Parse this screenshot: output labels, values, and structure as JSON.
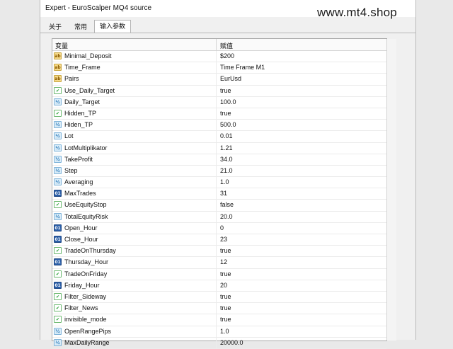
{
  "window": {
    "title": "Expert - EuroScalper MQ4 source",
    "watermark": "www.mt4.shop"
  },
  "tabs": [
    {
      "label": "关于"
    },
    {
      "label": "常用"
    },
    {
      "label": "输入参数",
      "active": true
    }
  ],
  "table": {
    "headers": {
      "variable": "变量",
      "value": "赋值"
    },
    "rows": [
      {
        "type": "ab",
        "icon": "ab",
        "name": "Minimal_Deposit",
        "value": "$200"
      },
      {
        "type": "ab",
        "icon": "ab",
        "name": "Time_Frame",
        "value": "Time Frame M1"
      },
      {
        "type": "ab",
        "icon": "ab",
        "name": "Pairs",
        "value": "EurUsd"
      },
      {
        "type": "bool",
        "icon": "✔",
        "name": "Use_Daily_Target",
        "value": "true"
      },
      {
        "type": "dbl",
        "icon": "½",
        "name": "Daily_Target",
        "value": "100.0"
      },
      {
        "type": "bool",
        "icon": "✔",
        "name": "Hidden_TP",
        "value": "true"
      },
      {
        "type": "dbl",
        "icon": "½",
        "name": "Hiden_TP",
        "value": "500.0"
      },
      {
        "type": "dbl",
        "icon": "½",
        "name": "Lot",
        "value": "0.01"
      },
      {
        "type": "dbl",
        "icon": "½",
        "name": "LotMultiplikator",
        "value": "1.21"
      },
      {
        "type": "dbl",
        "icon": "½",
        "name": "TakeProfit",
        "value": "34.0"
      },
      {
        "type": "dbl",
        "icon": "½",
        "name": "Step",
        "value": "21.0"
      },
      {
        "type": "dbl",
        "icon": "½",
        "name": "Averaging",
        "value": "1.0"
      },
      {
        "type": "int",
        "icon": "01",
        "name": "MaxTrades",
        "value": "31"
      },
      {
        "type": "bool",
        "icon": "✔",
        "name": "UseEquityStop",
        "value": "false"
      },
      {
        "type": "dbl",
        "icon": "½",
        "name": "TotalEquityRisk",
        "value": "20.0"
      },
      {
        "type": "int",
        "icon": "01",
        "name": "Open_Hour",
        "value": "0"
      },
      {
        "type": "int",
        "icon": "01",
        "name": "Close_Hour",
        "value": "23"
      },
      {
        "type": "bool",
        "icon": "✔",
        "name": "TradeOnThursday",
        "value": "true"
      },
      {
        "type": "int",
        "icon": "01",
        "name": "Thursday_Hour",
        "value": "12"
      },
      {
        "type": "bool",
        "icon": "✔",
        "name": "TradeOnFriday",
        "value": "true"
      },
      {
        "type": "int",
        "icon": "01",
        "name": "Friday_Hour",
        "value": "20"
      },
      {
        "type": "bool",
        "icon": "✔",
        "name": "Filter_Sideway",
        "value": "true"
      },
      {
        "type": "bool",
        "icon": "✔",
        "name": "Filter_News",
        "value": "true"
      },
      {
        "type": "bool",
        "icon": "✔",
        "name": "invisible_mode",
        "value": "true"
      },
      {
        "type": "dbl",
        "icon": "½",
        "name": "OpenRangePips",
        "value": "1.0"
      },
      {
        "type": "dbl",
        "icon": "½",
        "name": "MaxDailyRange",
        "value": "20000.0"
      }
    ]
  }
}
